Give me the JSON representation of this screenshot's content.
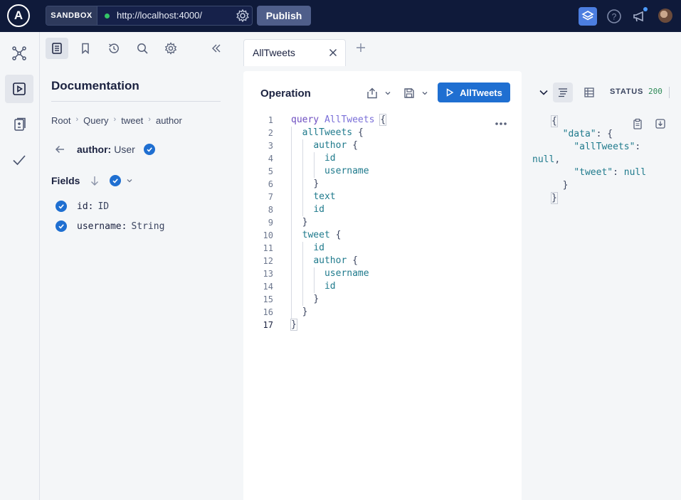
{
  "topbar": {
    "logo": "A",
    "env_tag": "SANDBOX",
    "url": "http://localhost:4000/",
    "publish_label": "Publish"
  },
  "docs": {
    "title": "Documentation",
    "breadcrumb": [
      "Root",
      "Query",
      "tweet",
      "author"
    ],
    "type_field": "author:",
    "type_name": "User",
    "fields_label": "Fields",
    "fields": [
      {
        "name": "id:",
        "type": "ID"
      },
      {
        "name": "username:",
        "type": "String"
      }
    ]
  },
  "tabs": [
    {
      "label": "AllTweets"
    }
  ],
  "operation": {
    "title": "Operation",
    "run_label": "AllTweets",
    "line_numbers": [
      "1",
      "2",
      "3",
      "4",
      "5",
      "6",
      "7",
      "8",
      "9",
      "10",
      "11",
      "12",
      "13",
      "14",
      "15",
      "16",
      "17"
    ]
  },
  "response": {
    "status_label": "STATUS",
    "status_code": "200"
  },
  "colors": {
    "topbar": "#0f1a3a",
    "accent": "#1f6fd1",
    "publish": "#4f5e8a"
  }
}
